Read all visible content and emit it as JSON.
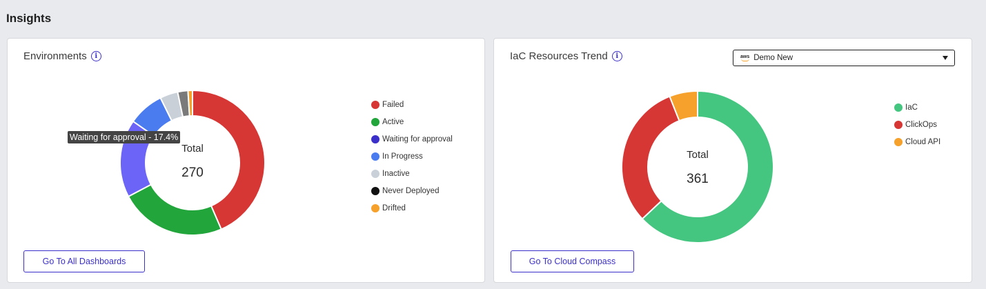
{
  "page": {
    "title": "Insights"
  },
  "environments": {
    "title": "Environments",
    "total_label": "Total",
    "total_value": "270",
    "tooltip": "Waiting for approval - 17.4%",
    "button_label": "Go To All Dashboards",
    "legend": [
      {
        "label": "Failed",
        "color": "#d63634"
      },
      {
        "label": "Active",
        "color": "#22a63b"
      },
      {
        "label": "Waiting for approval",
        "color": "#3b2fc9"
      },
      {
        "label": "In Progress",
        "color": "#4a7cf0"
      },
      {
        "label": "Inactive",
        "color": "#c9d0d8"
      },
      {
        "label": "Never Deployed",
        "color": "#111111"
      },
      {
        "label": "Drifted",
        "color": "#f5a12b"
      }
    ]
  },
  "iac": {
    "title": "IaC Resources Trend",
    "total_label": "Total",
    "total_value": "361",
    "button_label": "Go To Cloud Compass",
    "dropdown": {
      "selected": "Demo New",
      "icon": "aws-icon",
      "icon_text": "aws"
    },
    "legend": [
      {
        "label": "IaC",
        "color": "#45c680"
      },
      {
        "label": "ClickOps",
        "color": "#d63634"
      },
      {
        "label": "Cloud API",
        "color": "#f5a12b"
      }
    ]
  },
  "chart_data": [
    {
      "type": "pie",
      "title": "Environments",
      "categories": [
        "Failed",
        "Active",
        "Waiting for approval",
        "In Progress",
        "Inactive",
        "Never Deployed",
        "Drifted"
      ],
      "values": [
        43.5,
        23.8,
        17.4,
        8.0,
        4.0,
        2.3,
        1.0
      ],
      "colors": [
        "#d63634",
        "#22a63b",
        "#6b64f7",
        "#4a7cf0",
        "#c9d0d8",
        "#7a7a7a",
        "#f5a12b"
      ],
      "total": 270
    },
    {
      "type": "pie",
      "title": "IaC Resources Trend",
      "categories": [
        "IaC",
        "ClickOps",
        "Cloud API"
      ],
      "values": [
        63.0,
        31.0,
        6.0
      ],
      "colors": [
        "#45c680",
        "#d63634",
        "#f5a12b"
      ],
      "total": 361
    }
  ]
}
